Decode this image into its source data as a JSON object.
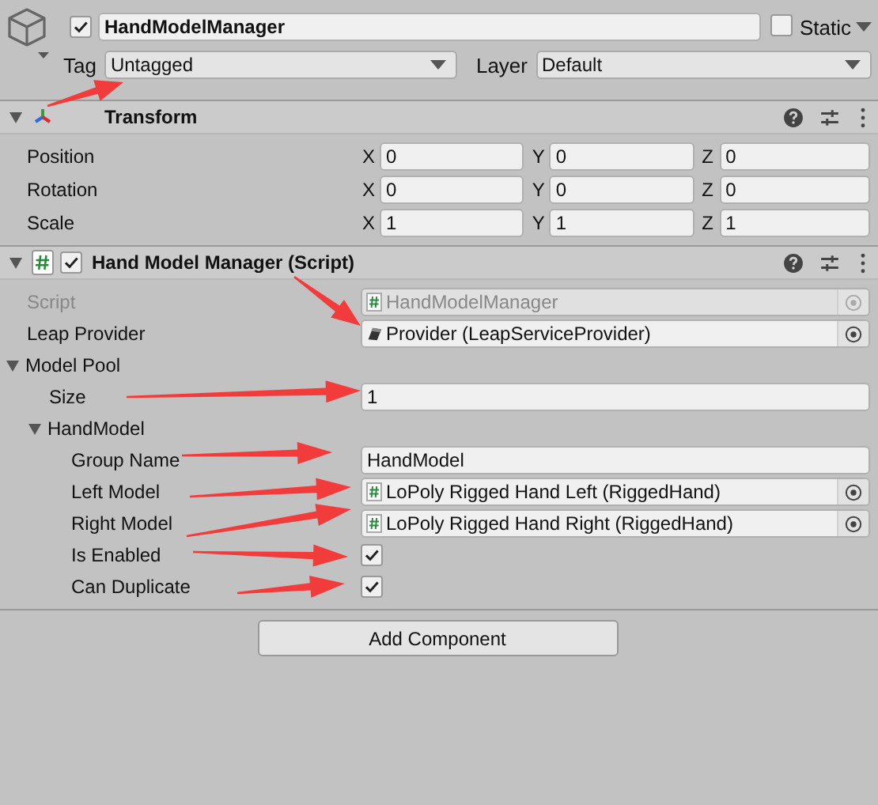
{
  "game_object": {
    "active": true,
    "name": "HandModelManager",
    "static": false,
    "static_label": "Static",
    "tag_label": "Tag",
    "tag": "Untagged",
    "layer_label": "Layer",
    "layer": "Default"
  },
  "components": [
    {
      "kind": "transform",
      "title": "Transform",
      "expanded": true,
      "rows": [
        {
          "label": "Position",
          "axes": [
            {
              "axis": "X",
              "value": "0"
            },
            {
              "axis": "Y",
              "value": "0"
            },
            {
              "axis": "Z",
              "value": "0"
            }
          ]
        },
        {
          "label": "Rotation",
          "axes": [
            {
              "axis": "X",
              "value": "0"
            },
            {
              "axis": "Y",
              "value": "0"
            },
            {
              "axis": "Z",
              "value": "0"
            }
          ]
        },
        {
          "label": "Scale",
          "axes": [
            {
              "axis": "X",
              "value": "1"
            },
            {
              "axis": "Y",
              "value": "1"
            },
            {
              "axis": "Z",
              "value": "1"
            }
          ]
        }
      ]
    },
    {
      "kind": "script",
      "title": "Hand Model Manager (Script)",
      "enabled": true,
      "expanded": true,
      "properties": [
        {
          "kind": "script",
          "label": "Script",
          "value": "HandModelManager",
          "disabled": true
        },
        {
          "kind": "provider",
          "label": "Leap Provider",
          "value": "Provider (LeapServiceProvider)",
          "disabled": false
        },
        {
          "kind": "foldout",
          "label": "Model Pool",
          "expanded": true,
          "children": [
            {
              "kind": "text",
              "label": "Size",
              "value": "1"
            },
            {
              "kind": "foldout",
              "label": "HandModel",
              "expanded": true,
              "children": [
                {
                  "kind": "text",
                  "label": "Group Name",
                  "value": "HandModel"
                },
                {
                  "kind": "script",
                  "label": "Left Model",
                  "value": "LoPoly Rigged Hand Left (RiggedHand)",
                  "disabled": false
                },
                {
                  "kind": "script",
                  "label": "Right Model",
                  "value": "LoPoly Rigged Hand Right (RiggedHand)",
                  "disabled": false
                },
                {
                  "kind": "checkbox",
                  "label": "Is Enabled",
                  "checked": true
                },
                {
                  "kind": "checkbox",
                  "label": "Can Duplicate",
                  "checked": true
                }
              ]
            }
          ]
        }
      ]
    }
  ],
  "add_component_button": "Add Component"
}
